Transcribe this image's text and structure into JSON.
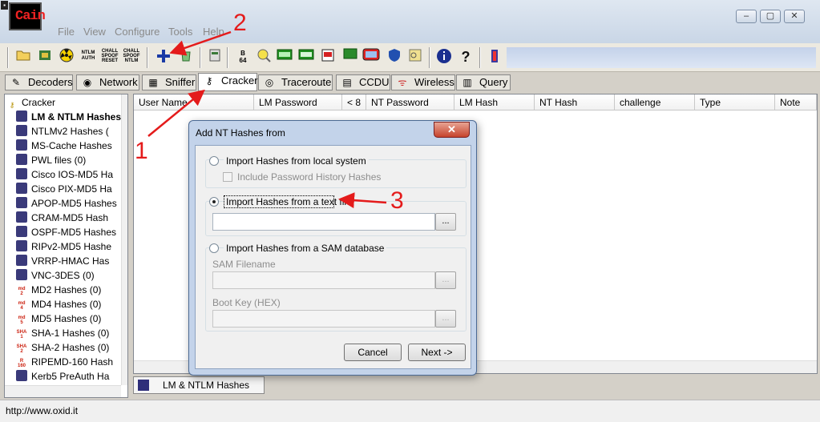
{
  "app": {
    "logo_text": "Cain",
    "menu": [
      "File",
      "View",
      "Configure",
      "Tools",
      "Help"
    ],
    "window_buttons": [
      "–",
      "▢",
      "✕"
    ]
  },
  "toolbar": {
    "icons": [
      "open-icon",
      "capture-icon",
      "radiation-icon",
      "ntlm-auth-icon",
      "chall-spoof-reset-icon",
      "chall-spoof-ntlm-icon",
      "add-icon",
      "recycle-icon",
      "decoder-icon",
      "base64-icon",
      "route-icon",
      "crack-icon",
      "vpn-icon",
      "rdp-icon",
      "console-icon",
      "red-icon",
      "shield-icon",
      "key-icon",
      "info-icon",
      "help-icon",
      "exit-icon"
    ],
    "labels": {
      "ntlm": "NTLM\nAUTH",
      "chall1": "CHALL\nSPOOF\nRESET",
      "chall2": "CHALL\nSPOOF\nNTLM",
      "b64": "B\n64"
    }
  },
  "tabs": [
    {
      "label": "Decoders",
      "icon": "decoder-icon"
    },
    {
      "label": "Network",
      "icon": "globe-icon"
    },
    {
      "label": "Sniffer",
      "icon": "sniffer-icon"
    },
    {
      "label": "Cracker",
      "icon": "key-icon",
      "active": true
    },
    {
      "label": "Traceroute",
      "icon": "traceroute-icon"
    },
    {
      "label": "CCDU",
      "icon": "ccdu-icon"
    },
    {
      "label": "Wireless",
      "icon": "wireless-icon"
    },
    {
      "label": "Query",
      "icon": "query-icon"
    }
  ],
  "tree": {
    "root": "Cracker",
    "items": [
      {
        "label": "LM & NTLM Hashes",
        "bold": true,
        "icon": "lm-hash-icon"
      },
      {
        "label": "NTLMv2 Hashes (",
        "icon": "ntlmv2-icon"
      },
      {
        "label": "MS-Cache Hashes",
        "icon": "mscache-icon"
      },
      {
        "label": "PWL files (0)",
        "icon": "pwl-icon"
      },
      {
        "label": "Cisco IOS-MD5 Ha",
        "icon": "cisco-ios-icon"
      },
      {
        "label": "Cisco PIX-MD5 Ha",
        "icon": "cisco-pix-icon"
      },
      {
        "label": "APOP-MD5 Hashes",
        "icon": "apop-icon"
      },
      {
        "label": "CRAM-MD5 Hash",
        "icon": "cram-icon"
      },
      {
        "label": "OSPF-MD5 Hashes",
        "icon": "ospf-icon"
      },
      {
        "label": "RIPv2-MD5 Hashe",
        "icon": "ripv2-icon"
      },
      {
        "label": "VRRP-HMAC Has",
        "icon": "vrrp-icon"
      },
      {
        "label": "VNC-3DES (0)",
        "icon": "vnc-icon"
      },
      {
        "label": "MD2 Hashes (0)",
        "icon": "md2-icon",
        "glyph": "md\n2"
      },
      {
        "label": "MD4 Hashes (0)",
        "icon": "md4-icon",
        "glyph": "md\n4"
      },
      {
        "label": "MD5 Hashes (0)",
        "icon": "md5-icon",
        "glyph": "md\n5"
      },
      {
        "label": "SHA-1 Hashes (0)",
        "icon": "sha1-icon",
        "glyph": "SHA\n1"
      },
      {
        "label": "SHA-2 Hashes (0)",
        "icon": "sha2-icon",
        "glyph": "SHA\n2"
      },
      {
        "label": "RIPEMD-160 Hash",
        "icon": "ripemd-icon",
        "glyph": "R\n160"
      },
      {
        "label": "Kerb5 PreAuth Ha",
        "icon": "kerb5-icon"
      }
    ]
  },
  "grid": {
    "columns": [
      "User Name",
      "LM Password",
      "< 8",
      "NT Password",
      "LM Hash",
      "NT Hash",
      "challenge",
      "Type",
      "Note"
    ]
  },
  "bottom_tab": "LM & NTLM Hashes",
  "status": "http://www.oxid.it",
  "dialog": {
    "title": "Add NT Hashes from",
    "close": "✕",
    "opt_local": "Import Hashes from local system",
    "opt_history": "Include Password History Hashes",
    "opt_text": "Import Hashes from a text file",
    "text_file_value": "",
    "browse": "...",
    "opt_sam": "Import Hashes from a SAM database",
    "sam_label": "SAM Filename",
    "bootkey_label": "Boot Key (HEX)",
    "cancel": "Cancel",
    "next": "Next ->"
  },
  "annotations": [
    "1",
    "2",
    "3"
  ]
}
